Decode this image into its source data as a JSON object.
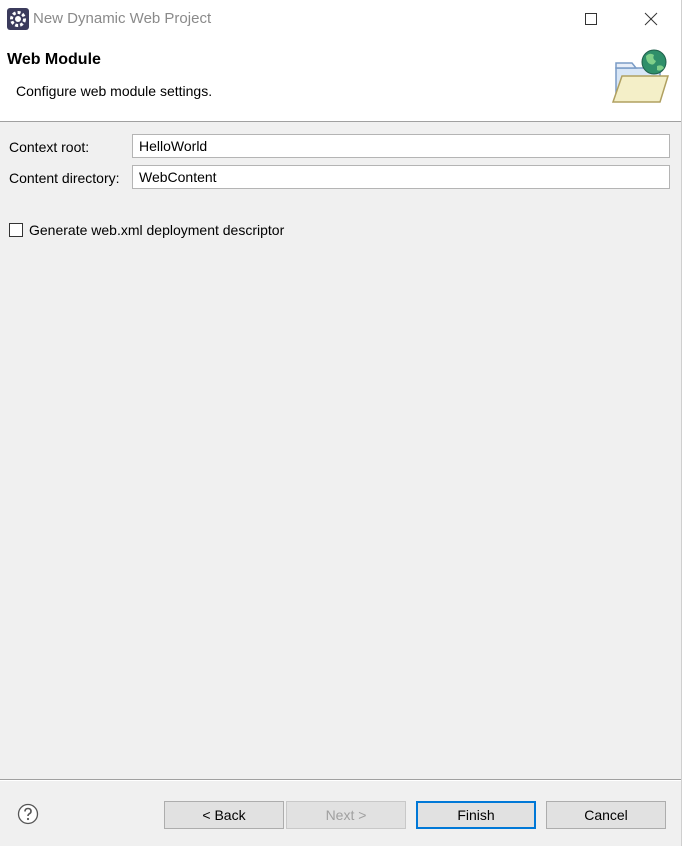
{
  "window": {
    "title": "New Dynamic Web Project",
    "app_icon": "eclipse-gear-icon",
    "controls": [
      "minimize-icon",
      "maximize-icon",
      "close-icon"
    ]
  },
  "header": {
    "title": "Web Module",
    "description": "Configure web module settings.",
    "icon": "web-folder-globe-icon"
  },
  "form": {
    "context_root": {
      "label": "Context root:",
      "value": "HelloWorld"
    },
    "content_directory": {
      "label": "Content directory:",
      "value": "WebContent"
    },
    "generate_web_xml": {
      "label": "Generate web.xml deployment descriptor",
      "checked": false
    }
  },
  "footer": {
    "help_icon": "question-mark-icon",
    "back_label": "< Back",
    "next_label": "Next >",
    "finish_label": "Finish",
    "cancel_label": "Cancel",
    "next_enabled": false,
    "default_button": "Finish"
  },
  "colors": {
    "dialog_bg": "#f0f0f0",
    "header_bg": "#ffffff",
    "default_button_border": "#0078d7",
    "disabled_text": "#a0a0a0"
  }
}
